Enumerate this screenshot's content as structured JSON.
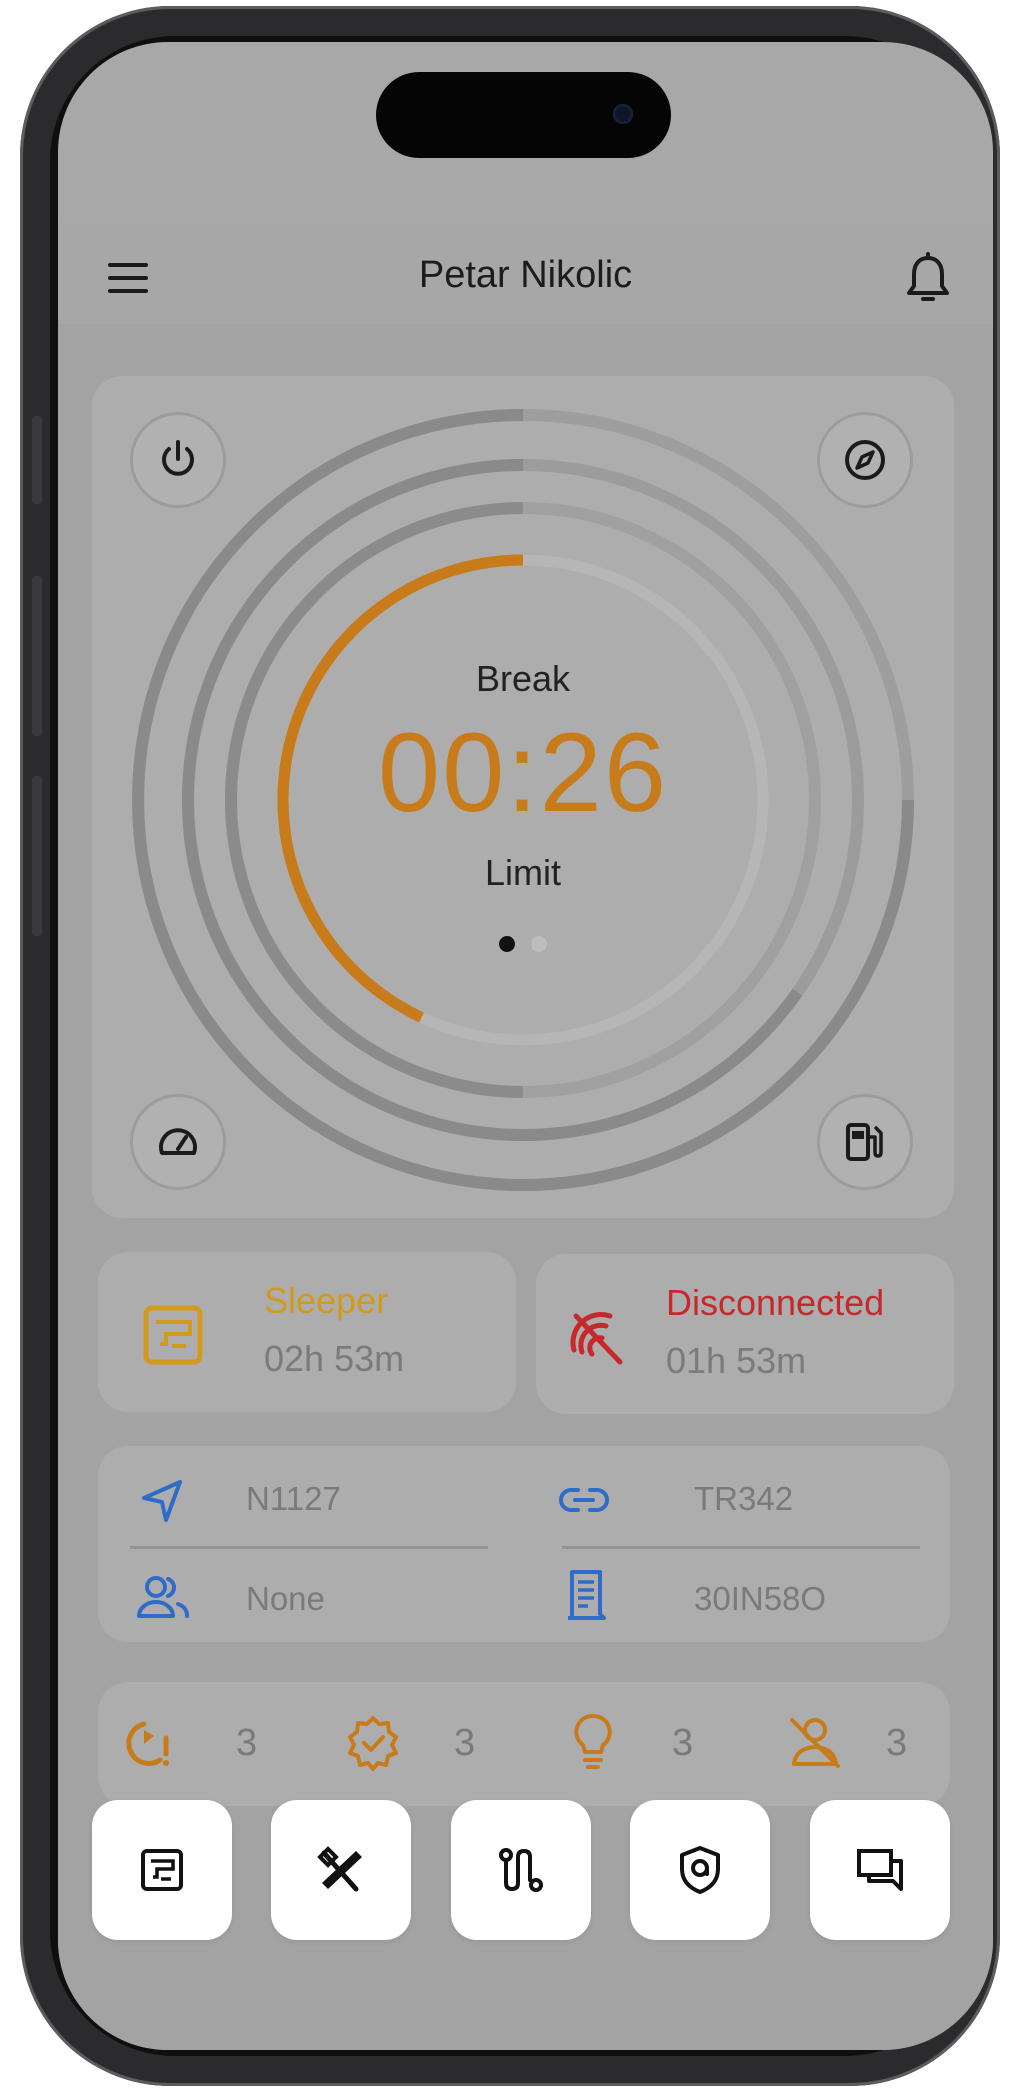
{
  "header": {
    "title": "Petar Nikolic",
    "menu_icon": "hamburger-menu-icon",
    "bell_icon": "bell-icon"
  },
  "gauge": {
    "label_top": "Break",
    "time": "00:26",
    "label_bottom": "Limit",
    "active_page_dot": 0,
    "page_count": 2,
    "progress_orange_fraction": 0.4,
    "accent_color": "#c87b1a"
  },
  "corner_buttons": {
    "top_left": "power-icon",
    "top_right": "compass-icon",
    "bottom_left": "speedometer-icon",
    "bottom_right": "fuel-pump-icon"
  },
  "status": {
    "sleeper": {
      "label": "Sleeper",
      "value": "02h 53m",
      "color": "#d29a1c"
    },
    "disconnected": {
      "label": "Disconnected",
      "value": "01h 53m",
      "color": "#c6282c"
    }
  },
  "info": {
    "location": "N1127",
    "trailer": "TR342",
    "codriver": "None",
    "document": "30IN58O",
    "icon_color": "#2f6cc9"
  },
  "counters": [
    {
      "icon": "timer-alert-icon",
      "value": "3"
    },
    {
      "icon": "badge-check-icon",
      "value": "3"
    },
    {
      "icon": "lightbulb-icon",
      "value": "3"
    },
    {
      "icon": "person-off-icon",
      "value": "3"
    }
  ],
  "bottom_nav": [
    {
      "icon": "logbook-icon"
    },
    {
      "icon": "tools-icon"
    },
    {
      "icon": "route-icon"
    },
    {
      "icon": "shield-icon"
    },
    {
      "icon": "chat-icon"
    }
  ]
}
